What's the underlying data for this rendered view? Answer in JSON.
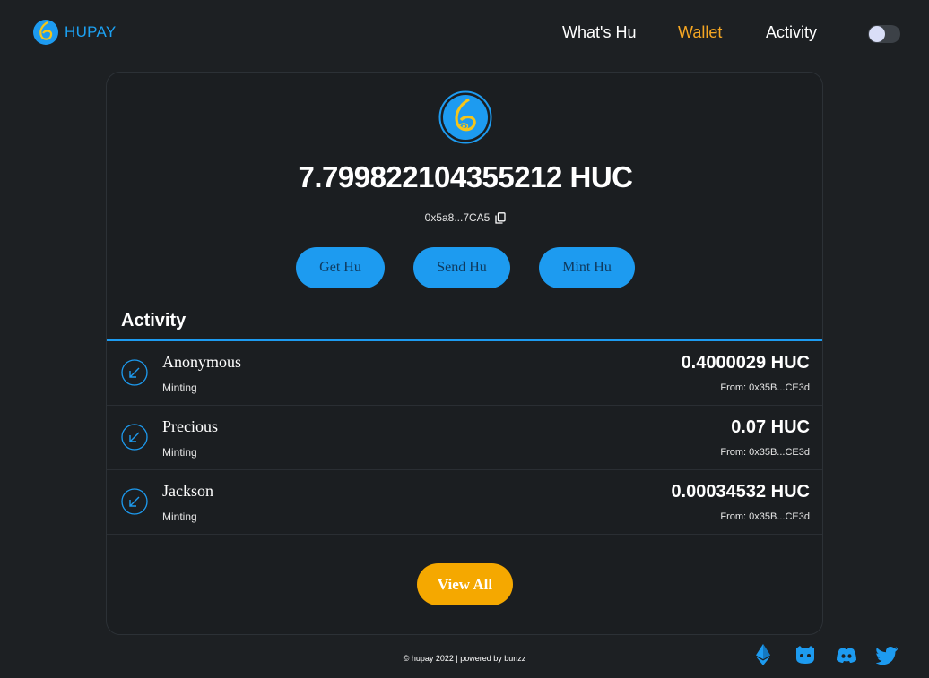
{
  "header": {
    "brand": "HUPAY",
    "nav": [
      {
        "label": "What's Hu"
      },
      {
        "label": "Wallet"
      },
      {
        "label": "Activity"
      }
    ]
  },
  "wallet": {
    "balance": "7.799822104355212 HUC",
    "address": "0x5a8...7CA5",
    "actions": [
      {
        "label": "Get Hu"
      },
      {
        "label": "Send Hu"
      },
      {
        "label": "Mint Hu"
      }
    ]
  },
  "activity": {
    "title": "Activity",
    "transactions": [
      {
        "name": "Anonymous",
        "type": "Minting",
        "amount": "0.4000029 HUC",
        "from": "From: 0x35B...CE3d"
      },
      {
        "name": "Precious",
        "type": "Minting",
        "amount": "0.07 HUC",
        "from": "From: 0x35B...CE3d"
      },
      {
        "name": "Jackson",
        "type": "Minting",
        "amount": "0.00034532 HUC",
        "from": "From: 0x35B...CE3d"
      }
    ],
    "view_all_label": "View All"
  },
  "footer": {
    "text": "© hupay 2022 | powered by bunzz",
    "icons": [
      "ethereum-icon",
      "github-icon",
      "discord-icon",
      "twitter-icon"
    ]
  },
  "colors": {
    "background": "#1d2023",
    "accent_blue": "#1d9bf0",
    "accent_orange": "#f5a800",
    "nav_active": "#f5a623"
  }
}
